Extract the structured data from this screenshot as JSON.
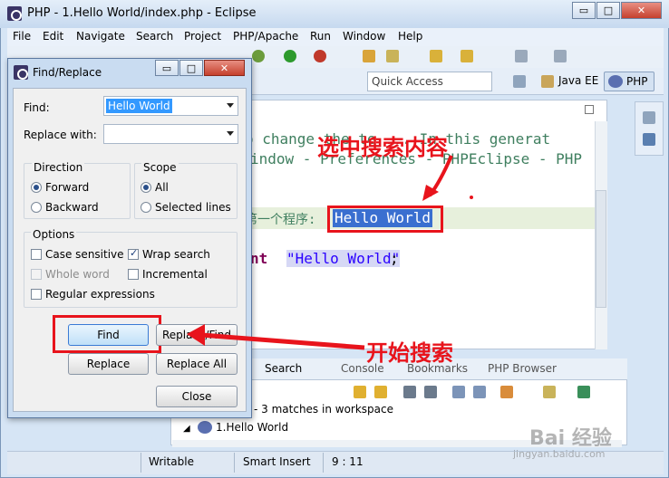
{
  "window": {
    "title": "PHP - 1.Hello World/index.php - Eclipse",
    "min": "▭",
    "max": "□",
    "close": "✕"
  },
  "menu": [
    "File",
    "Edit",
    "Navigate",
    "Search",
    "Project",
    "PHP/Apache",
    "Run",
    "Window",
    "Help"
  ],
  "perspective": {
    "quick_access_placeholder": "Quick Access",
    "java_ee": "Java EE",
    "php": "PHP"
  },
  "editor": {
    "line1": "o change the te ... In this generat",
    "line2": "indow - Preferences - PHPEclipse - PHP",
    "comment_prefix": "第一个程序:",
    "selected": "Hello World",
    "print_kw": "nt",
    "string": "\"Hello World\"",
    "semicolon": ";"
  },
  "search_panel": {
    "tabs": [
      "Search",
      "Console",
      "Bookmarks",
      "PHP Browser"
    ],
    "result_summary": "- 3 matches in workspace",
    "tree_item": "1.Hello World"
  },
  "status": {
    "writable": "Writable",
    "insert": "Smart Insert",
    "position": "9 : 11"
  },
  "dialog": {
    "title": "Find/Replace",
    "find_label": "Find:",
    "find_value": "Hello World",
    "replace_label": "Replace with:",
    "replace_value": "",
    "direction": {
      "title": "Direction",
      "forward": "Forward",
      "backward": "Backward"
    },
    "scope": {
      "title": "Scope",
      "all": "All",
      "selected_lines": "Selected lines"
    },
    "options": {
      "title": "Options",
      "case_sensitive": "Case sensitive",
      "wrap_search": "Wrap search",
      "whole_word": "Whole word",
      "incremental": "Incremental",
      "regex": "Regular expressions"
    },
    "buttons": {
      "find": "Find",
      "replace_find": "Replace/Find",
      "replace": "Replace",
      "replace_all": "Replace All",
      "close": "Close"
    }
  },
  "annotations": {
    "select_content": "选中搜索内容",
    "start_search": "开始搜索"
  },
  "watermark": {
    "brand": "Bai 经验",
    "url": "jingyan.baidu.com"
  },
  "colors": {
    "annotation": "#e8141c",
    "selection": "#3a6fd0"
  }
}
